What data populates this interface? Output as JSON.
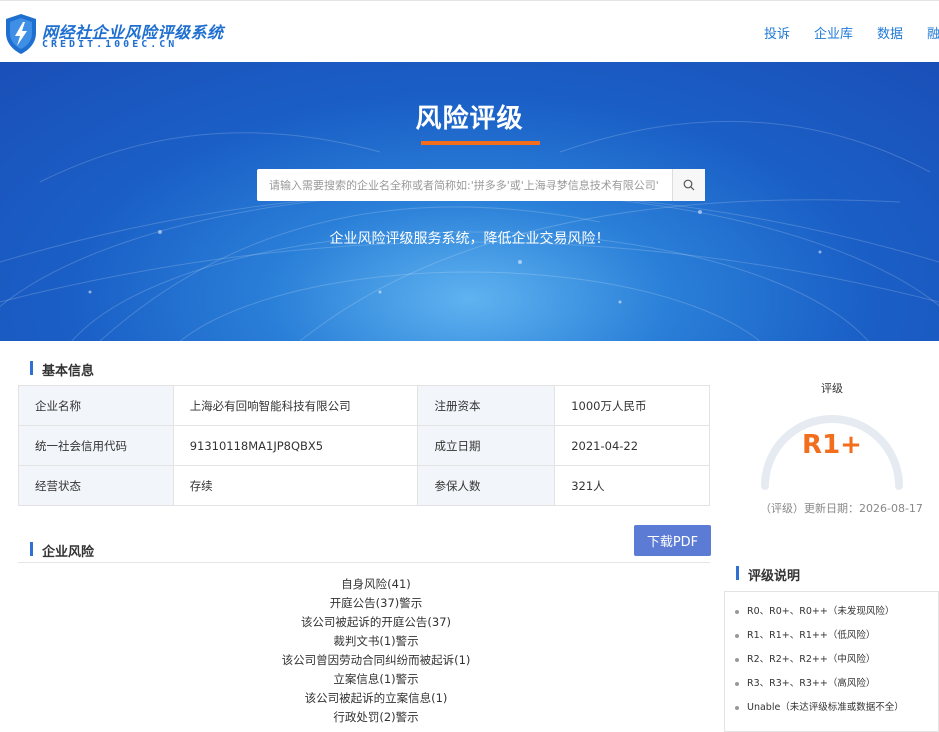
{
  "header": {
    "logo_title": "网经社企业风险评级系统",
    "logo_sub": "CREDIT.100EC.CN",
    "nav": [
      "投诉",
      "企业库",
      "数据",
      "融资"
    ]
  },
  "hero": {
    "title": "风险评级",
    "search_placeholder": "请输入需要搜索的企业名全称或者简称如:'拼多多'或'上海寻梦信息技术有限公司'",
    "slogan": "企业风险评级服务系统，降低企业交易风险！"
  },
  "basic": {
    "heading": "基本信息",
    "rows": [
      {
        "k1": "企业名称",
        "v1": "上海必有回响智能科技有限公司",
        "k2": "注册资本",
        "v2": "1000万人民币"
      },
      {
        "k1": "统一社会信用代码",
        "v1": "91310118MA1JP8QBX5",
        "k2": "成立日期",
        "v2": "2021-04-22"
      },
      {
        "k1": "经营状态",
        "v1": "存续",
        "k2": "参保人数",
        "v2": "321人"
      }
    ]
  },
  "rating": {
    "label": "评级",
    "value": "R1+",
    "update": "（评级）更新日期：2026-08-17",
    "accent": "#f26d1c"
  },
  "risk": {
    "heading": "企业风险",
    "pdf_button": "下载PDF",
    "items": [
      "自身风险(41)",
      "开庭公告(37)警示",
      "该公司被起诉的开庭公告(37)",
      "裁判文书(1)警示",
      "该公司曾因劳动合同纠纷而被起诉(1)",
      "立案信息(1)警示",
      "该公司被起诉的立案信息(1)",
      "行政处罚(2)警示"
    ]
  },
  "legend": {
    "heading": "评级说明",
    "items": [
      "R0、R0+、R0++（未发现风险）",
      "R1、R1+、R1++（低风险）",
      "R2、R2+、R2++（中风险）",
      "R3、R3+、R3++（高风险）",
      "Unable（未达评级标准或数据不全）"
    ]
  },
  "icons": {
    "logo": "shield-lightning-icon",
    "search": "search-icon"
  }
}
